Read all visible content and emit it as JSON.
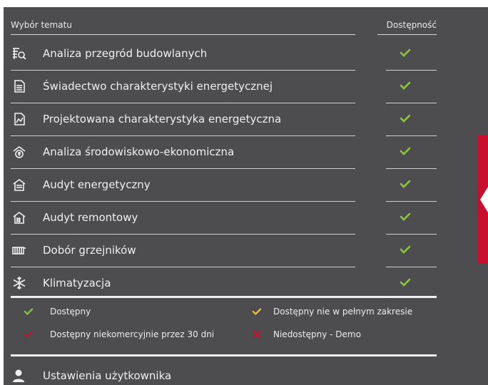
{
  "header": {
    "topic_title": "Wybór tematu",
    "availability_title": "Dostępność"
  },
  "topics": [
    {
      "label": "Analiza przegród budowlanych",
      "icon": "wall-analysis-icon",
      "status": "available"
    },
    {
      "label": "Świadectwo charakterystyki energetycznej",
      "icon": "certificate-icon",
      "status": "available"
    },
    {
      "label": "Projektowana charakterystyka energetyczna",
      "icon": "chart-document-icon",
      "status": "available"
    },
    {
      "label": "Analiza środowiskowo-ekonomiczna",
      "icon": "eco-analysis-icon",
      "status": "available"
    },
    {
      "label": "Audyt energetyczny",
      "icon": "house-energy-icon",
      "status": "available"
    },
    {
      "label": "Audyt remontowy",
      "icon": "house-renovation-icon",
      "status": "available"
    },
    {
      "label": "Dobór grzejników",
      "icon": "radiator-icon",
      "status": "available"
    },
    {
      "label": "Klimatyzacja",
      "icon": "snowflake-icon",
      "status": "available"
    }
  ],
  "legend": {
    "available": "Dostępny",
    "partial": "Dostępny nie w pełnym zakresie",
    "non_commercial": "Dostępny niekomercyjnie przez 30 dni",
    "unavailable": "Niedostępny - Demo"
  },
  "user_settings": {
    "label": "Ustawienia użytkownika",
    "icon": "user-icon"
  },
  "colors": {
    "panel_bg": "#4d4d4f",
    "available": "#8cc63f",
    "partial": "#f2c230",
    "non_commercial": "#c8102e",
    "unavailable": "#c8102e",
    "accent_tab": "#c8102e"
  }
}
